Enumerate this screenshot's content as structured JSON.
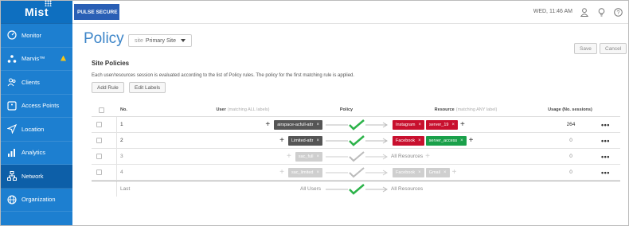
{
  "sidebar": {
    "logo": "Mist",
    "items": [
      {
        "label": "Monitor",
        "icon": "monitor-icon"
      },
      {
        "label": "Marvis™",
        "icon": "marvis-icon"
      },
      {
        "label": "Clients",
        "icon": "clients-icon"
      },
      {
        "label": "Access Points",
        "icon": "access-points-icon"
      },
      {
        "label": "Location",
        "icon": "location-icon"
      },
      {
        "label": "Analytics",
        "icon": "analytics-icon"
      },
      {
        "label": "Network",
        "icon": "network-icon"
      },
      {
        "label": "Organization",
        "icon": "organization-icon"
      }
    ],
    "active": "Network"
  },
  "header": {
    "brand": "PULSE SECURE",
    "clock": "WED, 11:46 AM"
  },
  "page": {
    "title": "Policy",
    "site_label": "site",
    "site_value": "Primary Site",
    "save": "Save",
    "cancel": "Cancel",
    "section_title": "Site Policies",
    "description": "Each user/resources session is evaluated according to the list of Policy rules. The policy for the first matching rule is applied.",
    "add_rule": "Add Rule",
    "edit_labels": "Edit Labels"
  },
  "table": {
    "columns": {
      "no": "No.",
      "user": "User",
      "user_sub": "(matching ALL labels)",
      "policy": "Policy",
      "resource": "Resource",
      "resource_sub": "(matching ANY label)",
      "usage": "Usage (No. sessions)"
    },
    "rows": [
      {
        "no": "1",
        "user_tag": "airspace-acfull-attr",
        "res_tags": [
          "Instagram",
          "server_19"
        ],
        "usage": "264"
      },
      {
        "no": "2",
        "user_tag": "Limited-attr",
        "res_tags": [
          "Facebook",
          "server_access"
        ],
        "usage": "0"
      },
      {
        "no": "3",
        "user_tag": "sac_full",
        "res_text": "All Resources",
        "usage": "0"
      },
      {
        "no": "4",
        "user_tag": "sac_limited",
        "res_tags": [
          "Facebook",
          "Gmail"
        ],
        "usage": "0"
      }
    ],
    "last_row": {
      "no": "Last",
      "users": "All Users",
      "resources": "All Resources"
    }
  },
  "colors": {
    "sidebar": "#1d7fd0",
    "accent": "#3b84c8",
    "allow": "#2db34a",
    "deny_tag": "#c8102e",
    "allow_tag": "#1aa04a"
  }
}
